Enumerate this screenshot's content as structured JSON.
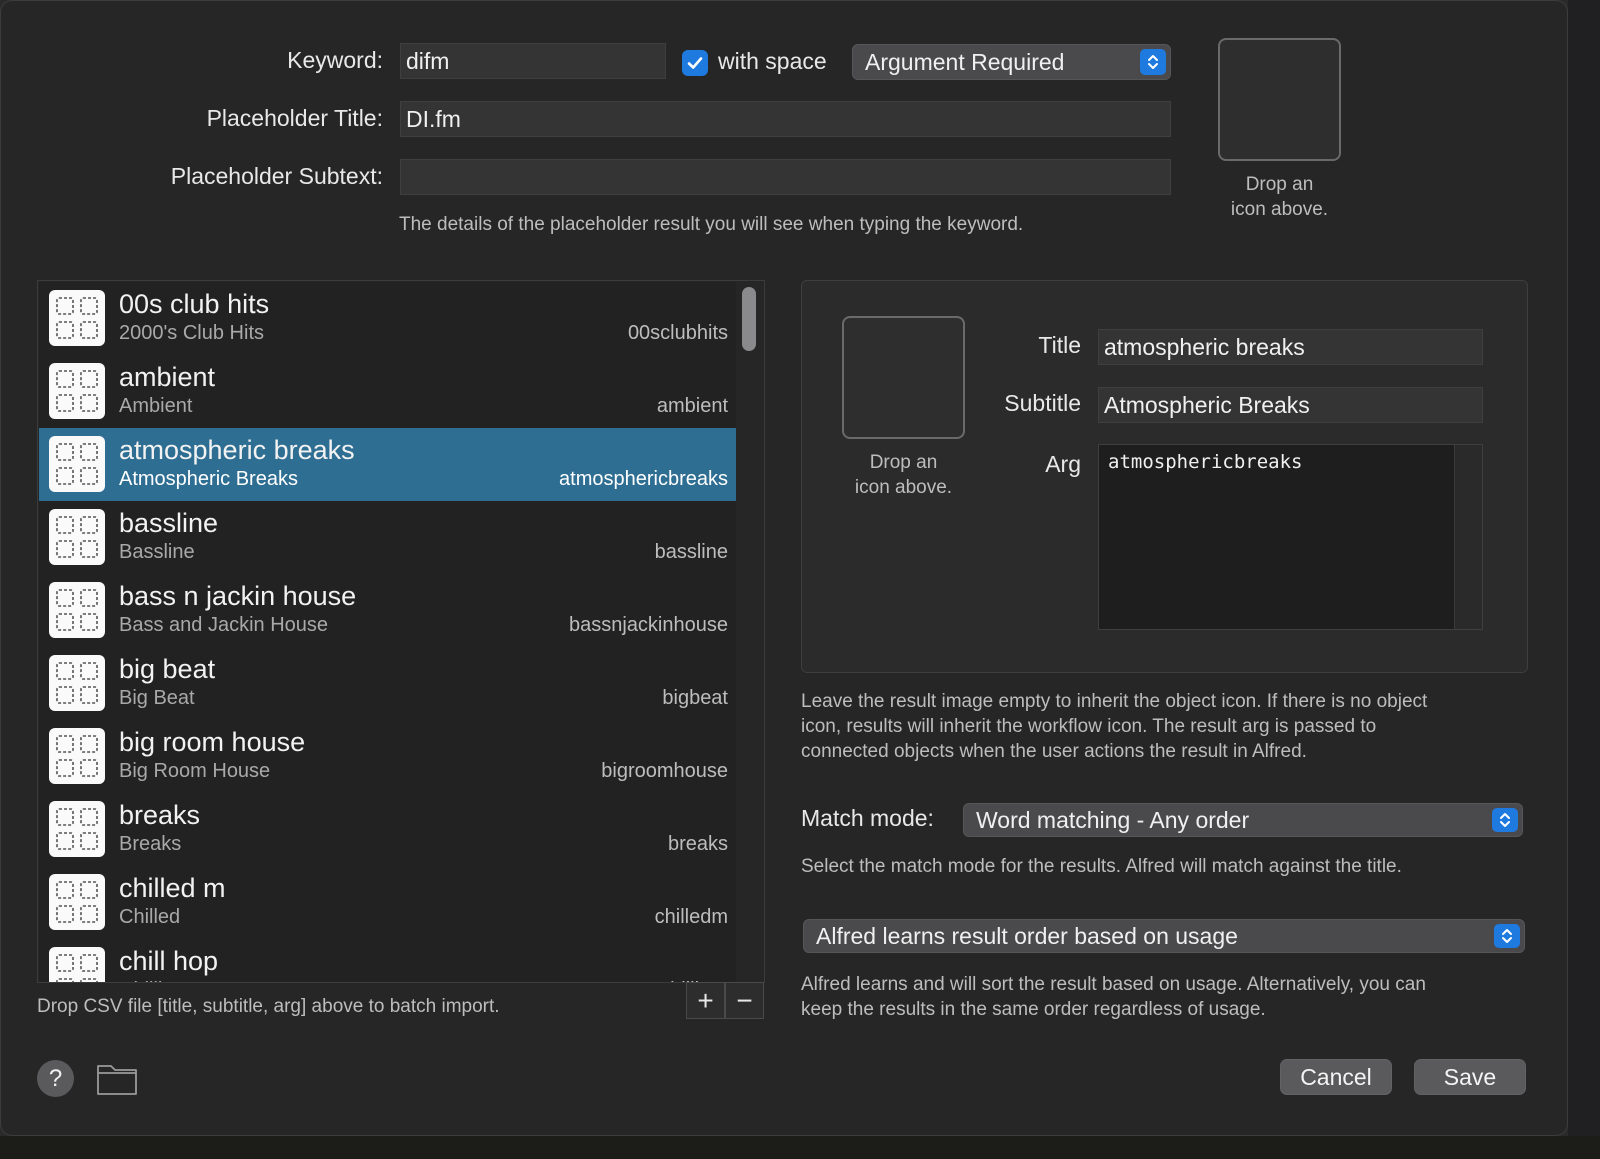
{
  "header": {
    "keyword_label": "Keyword:",
    "keyword_value": "difm",
    "with_space_label": "with space",
    "with_space_checked": true,
    "argument_select": "Argument Required",
    "placeholder_title_label": "Placeholder Title:",
    "placeholder_title_value": "DI.fm",
    "placeholder_subtext_label": "Placeholder Subtext:",
    "placeholder_subtext_value": "",
    "placeholder_help": "The details of the placeholder result you will see when typing the keyword.",
    "icon_drop_line1": "Drop an",
    "icon_drop_line2": "icon above."
  },
  "list": {
    "items": [
      {
        "title": "00s club hits",
        "subtitle": "2000's Club Hits",
        "arg": "00sclubhits"
      },
      {
        "title": "ambient",
        "subtitle": "Ambient",
        "arg": "ambient"
      },
      {
        "title": "atmospheric breaks",
        "subtitle": "Atmospheric Breaks",
        "arg": "atmosphericbreaks"
      },
      {
        "title": "bassline",
        "subtitle": "Bassline",
        "arg": "bassline"
      },
      {
        "title": "bass n jackin house",
        "subtitle": "Bass and Jackin House",
        "arg": "bassnjackinhouse"
      },
      {
        "title": "big beat",
        "subtitle": "Big Beat",
        "arg": "bigbeat"
      },
      {
        "title": "big room house",
        "subtitle": "Big Room House",
        "arg": "bigroomhouse"
      },
      {
        "title": "breaks",
        "subtitle": "Breaks",
        "arg": "breaks"
      },
      {
        "title": "chilled m",
        "subtitle": "Chilled",
        "arg": "chilledm"
      },
      {
        "title": "chill hop",
        "subtitle": "Chillhop",
        "arg": "chillhop"
      }
    ],
    "selected_index": 2,
    "csv_help": "Drop CSV file [title, subtitle, arg] above to batch import.",
    "add_label": "+",
    "remove_label": "−"
  },
  "detail": {
    "title_label": "Title",
    "title_value": "atmospheric breaks",
    "subtitle_label": "Subtitle",
    "subtitle_value": "Atmospheric Breaks",
    "arg_label": "Arg",
    "arg_value": "atmosphericbreaks",
    "icon_drop_line1": "Drop an",
    "icon_drop_line2": "icon above.",
    "inherit_help_1": "Leave the result image empty to inherit the object icon. If there is no object",
    "inherit_help_2": "icon, results will inherit the workflow icon. The result arg is passed to",
    "inherit_help_3": "connected objects when the user actions the result in Alfred.",
    "match_mode_label": "Match mode:",
    "match_mode_value": "Word matching - Any order",
    "match_help": "Select the match mode for the results. Alfred will match against the title.",
    "order_select": "Alfred learns result order based on usage",
    "order_help_1": "Alfred learns and will sort the result based on usage. Alternatively, you can",
    "order_help_2": "keep the results in the same order regardless of usage."
  },
  "footer": {
    "help_label": "?",
    "cancel_label": "Cancel",
    "save_label": "Save"
  },
  "colors": {
    "accent": "#1f7ae0",
    "selection": "#2e6e93",
    "background": "#262627"
  }
}
